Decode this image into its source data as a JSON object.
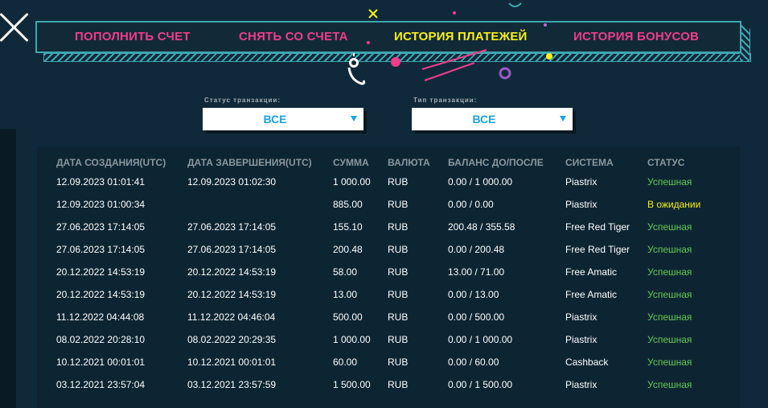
{
  "tabs": [
    {
      "label": "ПОПОЛНИТЬ СЧЕТ",
      "active": false
    },
    {
      "label": "СНЯТЬ СО СЧЕТА",
      "active": false
    },
    {
      "label": "ИСТОРИЯ ПЛАТЕЖЕЙ",
      "active": true
    },
    {
      "label": "ИСТОРИЯ БОНУСОВ",
      "active": false
    }
  ],
  "filters": {
    "status": {
      "label": "Статус транзакции:",
      "value": "ВСЕ"
    },
    "type": {
      "label": "Тип транзакции:",
      "value": "ВСЕ"
    }
  },
  "table": {
    "columns": [
      "ДАТА СОЗДАНИЯ(UTC)",
      "ДАТА ЗАВЕРШЕНИЯ(UTC)",
      "СУММА",
      "ВАЛЮТА",
      "БАЛАНС ДО/ПОСЛЕ",
      "СИСТЕМА",
      "СТАТУС"
    ],
    "rows": [
      [
        "12.09.2023 01:01:41",
        "12.09.2023 01:02:30",
        "1 000.00",
        "RUB",
        "0.00 / 1 000.00",
        "Piastrix",
        "Успешная"
      ],
      [
        "12.09.2023 01:00:34",
        "",
        "885.00",
        "RUB",
        "0.00 / 0.00",
        "Piastrix",
        "В ожидании"
      ],
      [
        "27.06.2023 17:14:05",
        "27.06.2023 17:14:05",
        "155.10",
        "RUB",
        "200.48 / 355.58",
        "Free Red Tiger",
        "Успешная"
      ],
      [
        "27.06.2023 17:14:05",
        "27.06.2023 17:14:05",
        "200.48",
        "RUB",
        "0.00 / 200.48",
        "Free Red Tiger",
        "Успешная"
      ],
      [
        "20.12.2022 14:53:19",
        "20.12.2022 14:53:19",
        "58.00",
        "RUB",
        "13.00 / 71.00",
        "Free Amatic",
        "Успешная"
      ],
      [
        "20.12.2022 14:53:19",
        "20.12.2022 14:53:19",
        "13.00",
        "RUB",
        "0.00 / 13.00",
        "Free Amatic",
        "Успешная"
      ],
      [
        "11.12.2022 04:44:08",
        "11.12.2022 04:46:04",
        "500.00",
        "RUB",
        "0.00 / 500.00",
        "Piastrix",
        "Успешная"
      ],
      [
        "08.02.2022 20:28:10",
        "08.02.2022 20:29:35",
        "1 000.00",
        "RUB",
        "0.00 / 1 000.00",
        "Piastrix",
        "Успешная"
      ],
      [
        "10.12.2021 00:01:01",
        "10.12.2021 00:01:01",
        "60.00",
        "RUB",
        "0.00 / 60.00",
        "Cashback",
        "Успешная"
      ],
      [
        "03.12.2021 23:57:04",
        "03.12.2021 23:57:59",
        "1 500.00",
        "RUB",
        "0.00 / 1 500.00",
        "Piastrix",
        "Успешная"
      ]
    ]
  },
  "colors": {
    "tab_inactive": "#ee3d8a",
    "tab_active": "#f8f019",
    "status_success": "#63c955",
    "status_pending": "#f5ef19",
    "select_text": "#1aa3e8"
  }
}
